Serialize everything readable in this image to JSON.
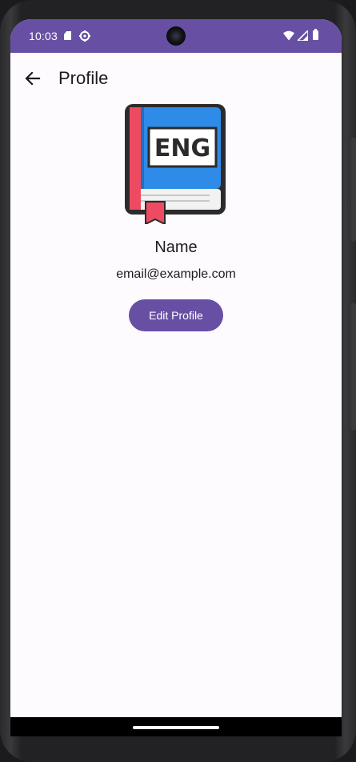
{
  "status_bar": {
    "time": "10:03",
    "icons": [
      "sd-card-icon",
      "gear-icon",
      "wifi-icon",
      "signal-icon",
      "battery-icon"
    ],
    "background": "#6750a4"
  },
  "app_bar": {
    "back_icon": "arrow-left-icon",
    "title": "Profile"
  },
  "profile": {
    "image_text": "ENG",
    "name": "Name",
    "email": "email@example.com",
    "edit_button_label": "Edit Profile"
  },
  "colors": {
    "primary": "#6750a4",
    "surface": "#fefbff",
    "on_surface": "#1c1b1f",
    "book_blue": "#2e8be8",
    "book_red": "#ee4b62"
  }
}
